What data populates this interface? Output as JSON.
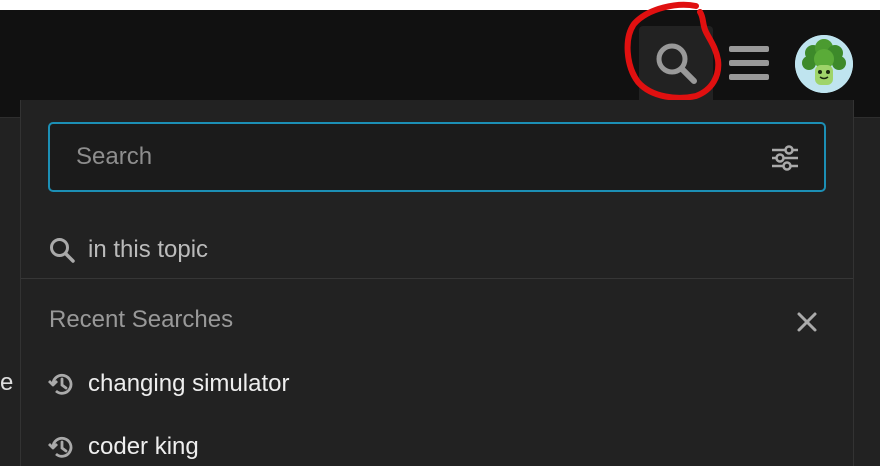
{
  "header": {
    "search_button_icon": "search-icon",
    "menu_icon": "hamburger-icon",
    "avatar_icon": "broccoli-avatar"
  },
  "background": {
    "partial_text": "e"
  },
  "search_panel": {
    "input": {
      "value": "",
      "placeholder": "Search"
    },
    "filter_icon": "sliders-icon",
    "context_option": {
      "icon": "search-icon",
      "label": "in this topic"
    },
    "recent": {
      "title": "Recent Searches",
      "clear_icon": "close-icon",
      "items": [
        {
          "icon": "history-icon",
          "label": "changing simulator"
        },
        {
          "icon": "history-icon",
          "label": "coder king"
        }
      ]
    }
  },
  "colors": {
    "accent": "#1c8fb5",
    "annotation": "#e01010",
    "header_bg": "#111111",
    "panel_bg": "#222222"
  }
}
